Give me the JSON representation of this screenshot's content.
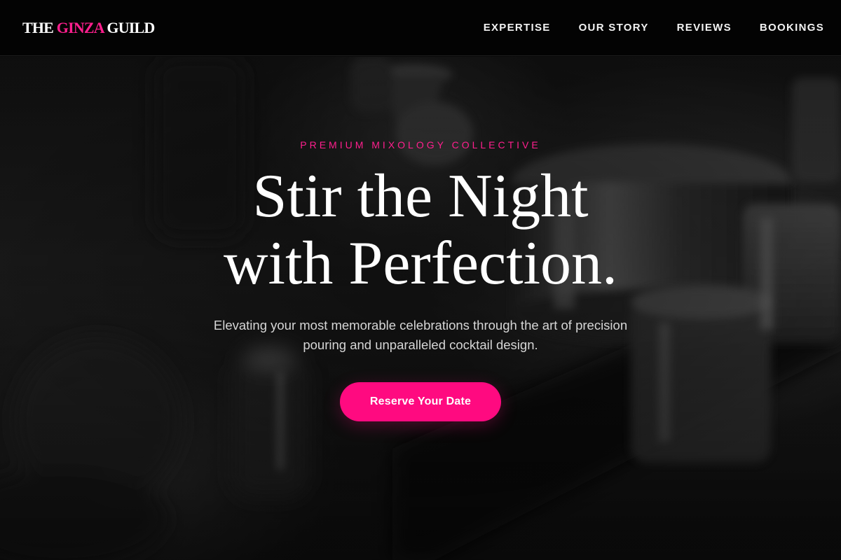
{
  "header": {
    "logo": {
      "part1": "THE",
      "accent": "GINZA",
      "part2": "GUILD"
    },
    "nav": [
      {
        "label": "EXPERTISE"
      },
      {
        "label": "OUR STORY"
      },
      {
        "label": "REVIEWS"
      },
      {
        "label": "BOOKINGS"
      }
    ]
  },
  "hero": {
    "eyebrow": "PREMIUM MIXOLOGY COLLECTIVE",
    "headline_line1": "Stir the Night",
    "headline_line2": "with Perfection.",
    "subtext": "Elevating your most memorable celebrations through the art of precision pouring and unparalleled cocktail design.",
    "cta_label": "Reserve Your Date"
  },
  "colors": {
    "accent": "#ff1f8e",
    "button": "#ff0a80",
    "header_bg": "#030303",
    "text": "#ffffff"
  }
}
